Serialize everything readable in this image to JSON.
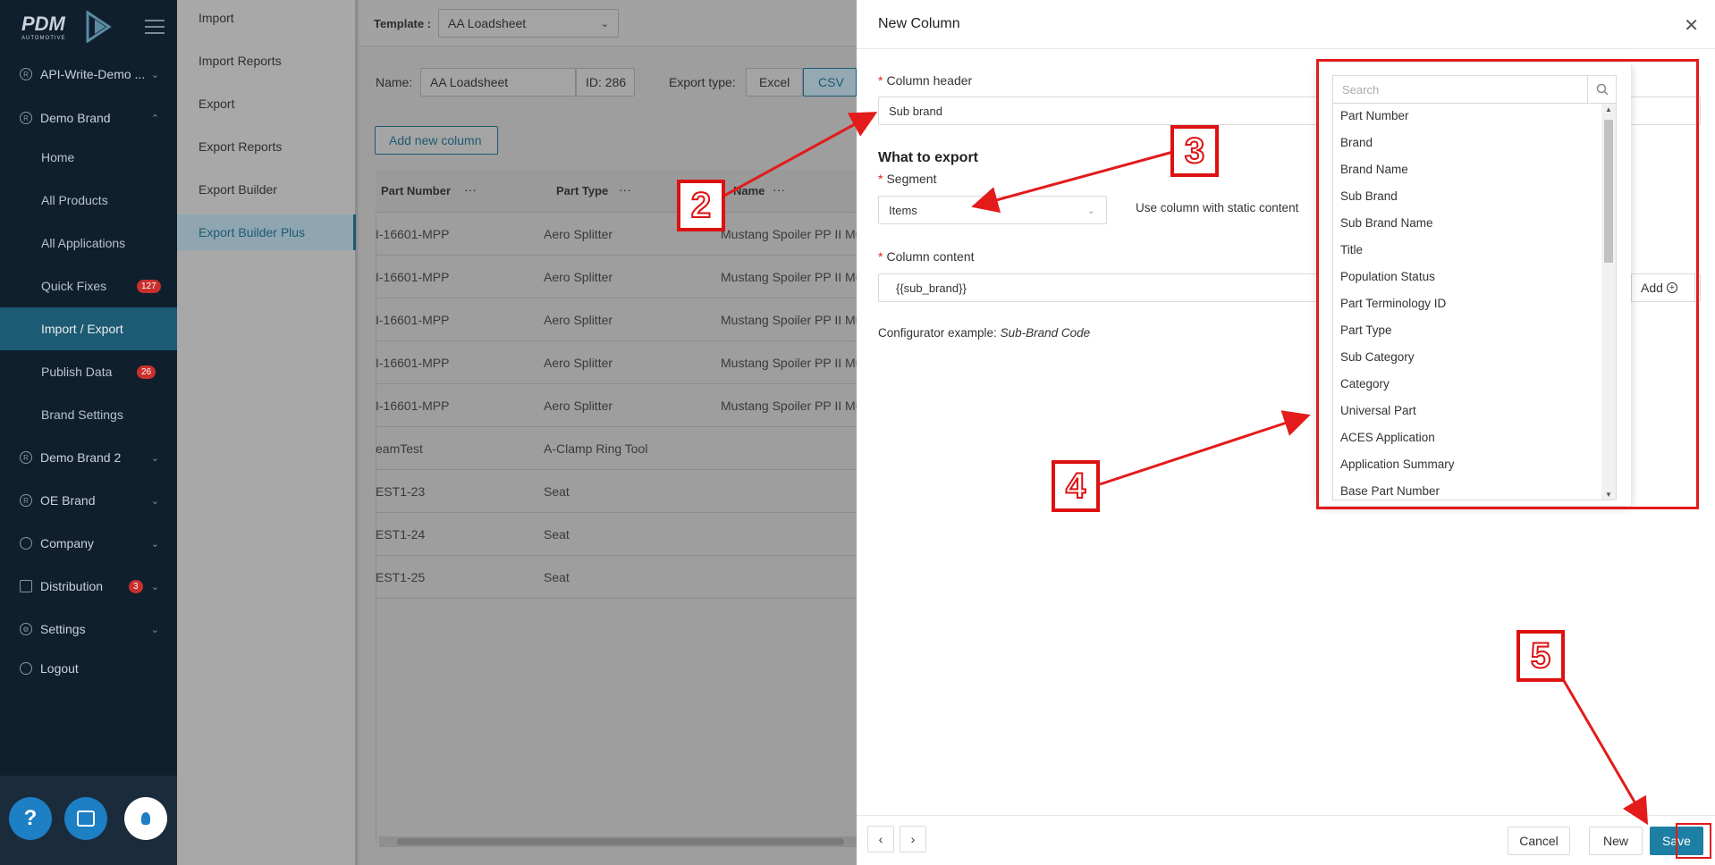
{
  "sidebar": {
    "logo_text": "PDM",
    "logo_sub": "AUTOMOTIVE",
    "items": [
      {
        "label": "API-Write-Demo ...",
        "icon": "registered-icon"
      },
      {
        "label": "Demo Brand",
        "icon": "registered-icon"
      },
      {
        "label": "Home"
      },
      {
        "label": "All Products"
      },
      {
        "label": "All Applications"
      },
      {
        "label": "Quick Fixes",
        "badge": "127"
      },
      {
        "label": "Import / Export"
      },
      {
        "label": "Publish Data",
        "badge": "26"
      },
      {
        "label": "Brand Settings"
      },
      {
        "label": "Demo Brand 2",
        "icon": "registered-icon"
      },
      {
        "label": "OE Brand",
        "icon": "registered-icon"
      },
      {
        "label": "Company",
        "icon": "globe-icon"
      },
      {
        "label": "Distribution",
        "icon": "distribution-icon",
        "badge": "3"
      },
      {
        "label": "Settings",
        "icon": "gear-icon"
      },
      {
        "label": "Logout",
        "icon": "logout-icon"
      }
    ],
    "help_label": "?"
  },
  "submenu": {
    "items": [
      "Import",
      "Import Reports",
      "Export",
      "Export Reports",
      "Export Builder",
      "Export Builder Plus"
    ]
  },
  "main": {
    "template_label": "Template :",
    "template_value": "AA Loadsheet",
    "name_label": "Name:",
    "name_value": "AA Loadsheet",
    "id_value": "ID: 286",
    "export_type_label": "Export type:",
    "export_excel": "Excel",
    "export_csv": "CSV",
    "add_column_button": "Add new column",
    "columns": [
      "Part Number",
      "Part Type",
      "Name"
    ],
    "rows": [
      [
        "I-16601-MPP",
        "Aero Splitter",
        "Mustang Spoiler PP II Mu"
      ],
      [
        "I-16601-MPP",
        "Aero Splitter",
        "Mustang Spoiler PP II Mu"
      ],
      [
        "I-16601-MPP",
        "Aero Splitter",
        "Mustang Spoiler PP II Mu"
      ],
      [
        "I-16601-MPP",
        "Aero Splitter",
        "Mustang Spoiler PP II Mu"
      ],
      [
        "I-16601-MPP",
        "Aero Splitter",
        "Mustang Spoiler PP II Mu"
      ],
      [
        "eamTest",
        "A-Clamp Ring Tool",
        ""
      ],
      [
        "EST1-23",
        "Seat",
        ""
      ],
      [
        "EST1-24",
        "Seat",
        ""
      ],
      [
        "EST1-25",
        "Seat",
        ""
      ]
    ]
  },
  "drawer": {
    "title": "New Column",
    "column_header_label": "Column header",
    "column_header_value": "Sub brand",
    "what_to_export": "What to export",
    "segment_label": "Segment",
    "segment_value": "Items",
    "static_content_label": "Use column with static content",
    "column_content_label": "Column content",
    "column_content_value": "{{sub_brand}}",
    "add_button": "Add",
    "configurator_label": "Configurator example:",
    "configurator_value": "Sub-Brand Code",
    "cancel": "Cancel",
    "new": "New",
    "save": "Save"
  },
  "dropdown": {
    "search_placeholder": "Search",
    "options": [
      "Part Number",
      "Brand",
      "Brand Name",
      "Sub Brand",
      "Sub Brand Name",
      "Title",
      "Population Status",
      "Part Terminology ID",
      "Part Type",
      "Sub Category",
      "Category",
      "Universal Part",
      "ACES Application",
      "Application Summary",
      "Base Part Number"
    ]
  },
  "annotations": [
    "2",
    "3",
    "4",
    "5"
  ],
  "colors": {
    "accent": "#1d7fa3",
    "annotation": "#e31b1b",
    "sidebar": "#0f1f2e"
  }
}
